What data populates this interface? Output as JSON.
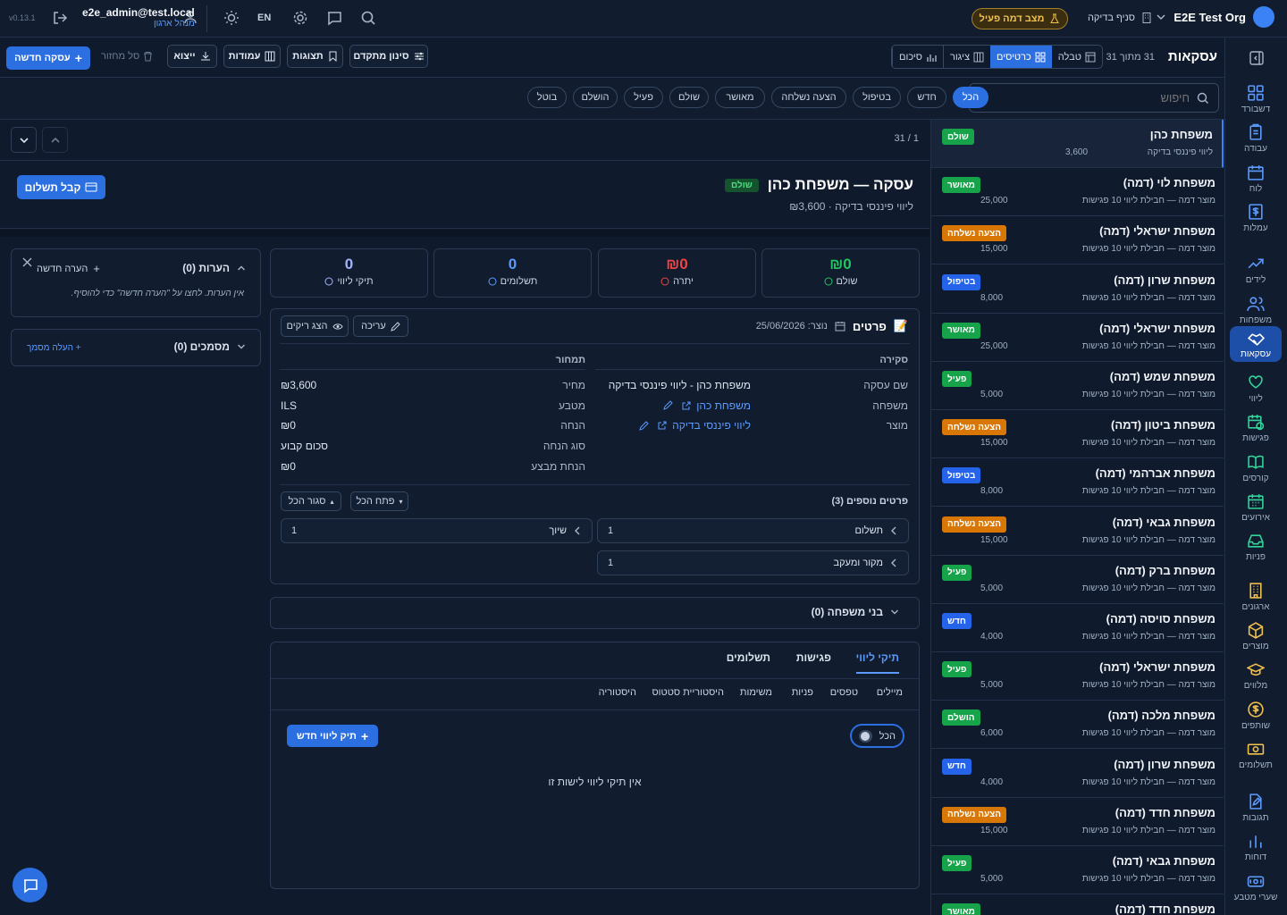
{
  "topbar": {
    "org": "E2E Test Org",
    "branch": "סניף בדיקה",
    "mock_mode": "מצב דמה פעיל",
    "lang": "EN",
    "user_email": "e2e_admin@test.local",
    "user_role": "מנהל ארגון",
    "version": "v0.13.1"
  },
  "sidebar": {
    "items": [
      {
        "label": "דשבורד",
        "icon": "dashboard-icon"
      },
      {
        "label": "עבודה",
        "icon": "clipboard-icon"
      },
      {
        "label": "לוח",
        "icon": "calendar-icon"
      },
      {
        "label": "עמלות",
        "icon": "dollar-icon"
      },
      {
        "label": "לידים",
        "icon": "trending-up-icon"
      },
      {
        "label": "משפחות",
        "icon": "users-icon"
      },
      {
        "label": "עסקאות",
        "icon": "handshake-icon"
      },
      {
        "label": "ליווי",
        "icon": "heart-hand-icon"
      },
      {
        "label": "פגישות",
        "icon": "calendar-clock-icon"
      },
      {
        "label": "קורסים",
        "icon": "book-icon"
      },
      {
        "label": "אירועים",
        "icon": "calendar-grid-icon"
      },
      {
        "label": "פניות",
        "icon": "inbox-icon"
      },
      {
        "label": "ארגונים",
        "icon": "building-icon"
      },
      {
        "label": "מוצרים",
        "icon": "box-icon"
      },
      {
        "label": "מלווים",
        "icon": "graduation-cap-icon"
      },
      {
        "label": "שותפים",
        "icon": "coin-icon"
      },
      {
        "label": "תשלומים",
        "icon": "banknote-icon"
      },
      {
        "label": "תגובות",
        "icon": "file-edit-icon"
      },
      {
        "label": "דוחות",
        "icon": "bar-chart-icon"
      },
      {
        "label": "שערי מטבע",
        "icon": "currency-icon"
      }
    ]
  },
  "toolbar": {
    "title": "עסקאות",
    "count": "31 מתוך 31",
    "views": [
      "טבלה",
      "כרטיסים",
      "ציגור",
      "סיכום"
    ],
    "filter_adv": "סינון מתקדם",
    "views_btn": "תצוגות",
    "columns_btn": "עמודות",
    "export_btn": "ייצוא",
    "trash_btn": "סל מחזור",
    "new_btn": "עסקה חדשה"
  },
  "search": {
    "placeholder": "חיפוש"
  },
  "chips": [
    "הכל",
    "חדש",
    "בטיפול",
    "הצעה נשלחה",
    "מאושר",
    "שולם",
    "פעיל",
    "הושלם",
    "בוטל"
  ],
  "pager": "31 / 1",
  "deals": [
    {
      "name": "משפחת כהן",
      "sub": "ליווי פיננסי בדיקה",
      "amount": "3,600",
      "status": "שולם",
      "color": "#16a34a"
    },
    {
      "name": "משפחת לוי (דמה)",
      "sub": "מוצר דמה — חבילת ליווי 10 פגישות",
      "amount": "25,000",
      "status": "מאושר",
      "color": "#16a34a"
    },
    {
      "name": "משפחת ישראלי (דמה)",
      "sub": "מוצר דמה — חבילת ליווי 10 פגישות",
      "amount": "15,000",
      "status": "הצעה נשלחה",
      "color": "#d97706"
    },
    {
      "name": "משפחת שרון (דמה)",
      "sub": "מוצר דמה — חבילת ליווי 10 פגישות",
      "amount": "8,000",
      "status": "בטיפול",
      "color": "#2563eb"
    },
    {
      "name": "משפחת ישראלי (דמה)",
      "sub": "מוצר דמה — חבילת ליווי 10 פגישות",
      "amount": "25,000",
      "status": "מאושר",
      "color": "#16a34a"
    },
    {
      "name": "משפחת שמש (דמה)",
      "sub": "מוצר דמה — חבילת ליווי 10 פגישות",
      "amount": "5,000",
      "status": "פעיל",
      "color": "#16a34a"
    },
    {
      "name": "משפחת ביטון (דמה)",
      "sub": "מוצר דמה — חבילת ליווי 10 פגישות",
      "amount": "15,000",
      "status": "הצעה נשלחה",
      "color": "#d97706"
    },
    {
      "name": "משפחת אברהמי (דמה)",
      "sub": "מוצר דמה — חבילת ליווי 10 פגישות",
      "amount": "8,000",
      "status": "בטיפול",
      "color": "#2563eb"
    },
    {
      "name": "משפחת גבאי (דמה)",
      "sub": "מוצר דמה — חבילת ליווי 10 פגישות",
      "amount": "15,000",
      "status": "הצעה נשלחה",
      "color": "#d97706"
    },
    {
      "name": "משפחת ברק (דמה)",
      "sub": "מוצר דמה — חבילת ליווי 10 פגישות",
      "amount": "5,000",
      "status": "פעיל",
      "color": "#16a34a"
    },
    {
      "name": "משפחת סויסה (דמה)",
      "sub": "מוצר דמה — חבילת ליווי 10 פגישות",
      "amount": "4,000",
      "status": "חדש",
      "color": "#2563eb"
    },
    {
      "name": "משפחת ישראלי (דמה)",
      "sub": "מוצר דמה — חבילת ליווי 10 פגישות",
      "amount": "5,000",
      "status": "פעיל",
      "color": "#16a34a"
    },
    {
      "name": "משפחת מלכה (דמה)",
      "sub": "מוצר דמה — חבילת ליווי 10 פגישות",
      "amount": "6,000",
      "status": "הושלם",
      "color": "#16a34a"
    },
    {
      "name": "משפחת שרון (דמה)",
      "sub": "מוצר דמה — חבילת ליווי 10 פגישות",
      "amount": "4,000",
      "status": "חדש",
      "color": "#2563eb"
    },
    {
      "name": "משפחת חדד (דמה)",
      "sub": "מוצר דמה — חבילת ליווי 10 פגישות",
      "amount": "15,000",
      "status": "הצעה נשלחה",
      "color": "#d97706"
    },
    {
      "name": "משפחת גבאי (דמה)",
      "sub": "מוצר דמה — חבילת ליווי 10 פגישות",
      "amount": "5,000",
      "status": "פעיל",
      "color": "#16a34a"
    },
    {
      "name": "משפחת חדד (דמה)",
      "sub": "",
      "amount": "",
      "status": "מאושר",
      "color": "#16a34a"
    }
  ],
  "detail": {
    "title": "עסקה — משפחת כהן",
    "status": "שולם",
    "subtitle": "ליווי פיננסי בדיקה · ₪3,600",
    "pay_btn": "קבל תשלום",
    "stats": [
      {
        "value": "₪0",
        "label": "שולם",
        "color": "#22c55e"
      },
      {
        "value": "₪0",
        "label": "יתרה",
        "color": "#ef4444"
      },
      {
        "value": "0",
        "label": "תשלומים",
        "color": "#5b9bff"
      },
      {
        "value": "0",
        "label": "תיקי ליווי",
        "color": "#a5b4fc"
      }
    ],
    "details_title": "פרטים",
    "created": "נוצר: 25/06/2026",
    "edit": "עריכה",
    "show_empty": "הצג ריקים",
    "overview_title": "סקירה",
    "pricing_title": "תמחור",
    "overview": [
      {
        "label": "שם עסקה",
        "value": "משפחת כהן - ליווי פיננסי בדיקה"
      },
      {
        "label": "משפחה",
        "value": "משפחת כהן"
      },
      {
        "label": "מוצר",
        "value": "ליווי פיננסי בדיקה"
      }
    ],
    "pricing": [
      {
        "label": "מחיר",
        "value": "₪3,600"
      },
      {
        "label": "מטבע",
        "value": "ILS"
      },
      {
        "label": "הנחה",
        "value": "₪0"
      },
      {
        "label": "סוג הנחה",
        "value": "סכום קבוע"
      },
      {
        "label": "הנחת מבצע",
        "value": "₪0"
      }
    ],
    "extra_title": "פרטים נוספים (3)",
    "open_all": "פתח הכל",
    "close_all": "סגור הכל",
    "extra": [
      {
        "label": "תשלום",
        "value": "1"
      },
      {
        "label": "שיוך",
        "value": "1"
      },
      {
        "label": "מקור ומעקב",
        "value": "1"
      }
    ],
    "family_members": "בני משפחה (0)",
    "tabs": [
      "תיקי ליווי",
      "פגישות",
      "תשלומים"
    ],
    "subtabs": [
      "מיילים",
      "טפסים",
      "פניות",
      "משימות",
      "היסטוריית סטטוס",
      "היסטוריה"
    ],
    "all_toggle": "הכל",
    "new_file_btn": "תיק ליווי חדש",
    "empty": "אין תיקי ליווי לישות זו",
    "notes_title": "הערות (0)",
    "new_note": "הערה חדשה",
    "notes_empty": "אין הערות. לחצו על \"הערה חדשה\" כדי להוסיף.",
    "docs_title": "מסמכים (0)",
    "upload_doc": "+ העלה מסמך"
  }
}
